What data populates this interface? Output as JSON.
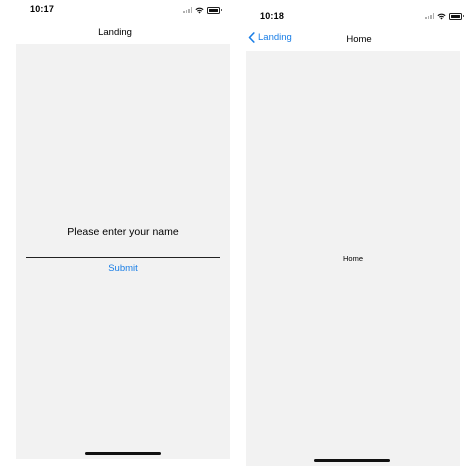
{
  "left_screen": {
    "status_bar": {
      "time": "10:17"
    },
    "nav_bar": {
      "title": "Landing"
    },
    "form": {
      "prompt": "Please enter your name",
      "name_value": "",
      "submit_label": "Submit"
    }
  },
  "right_screen": {
    "status_bar": {
      "time": "10:18"
    },
    "nav_bar": {
      "title": "Home",
      "back_label": "Landing"
    },
    "body": {
      "label": "Home"
    }
  },
  "colors": {
    "accent": "#1a7ee6",
    "content_background": "#f2f2f2"
  }
}
